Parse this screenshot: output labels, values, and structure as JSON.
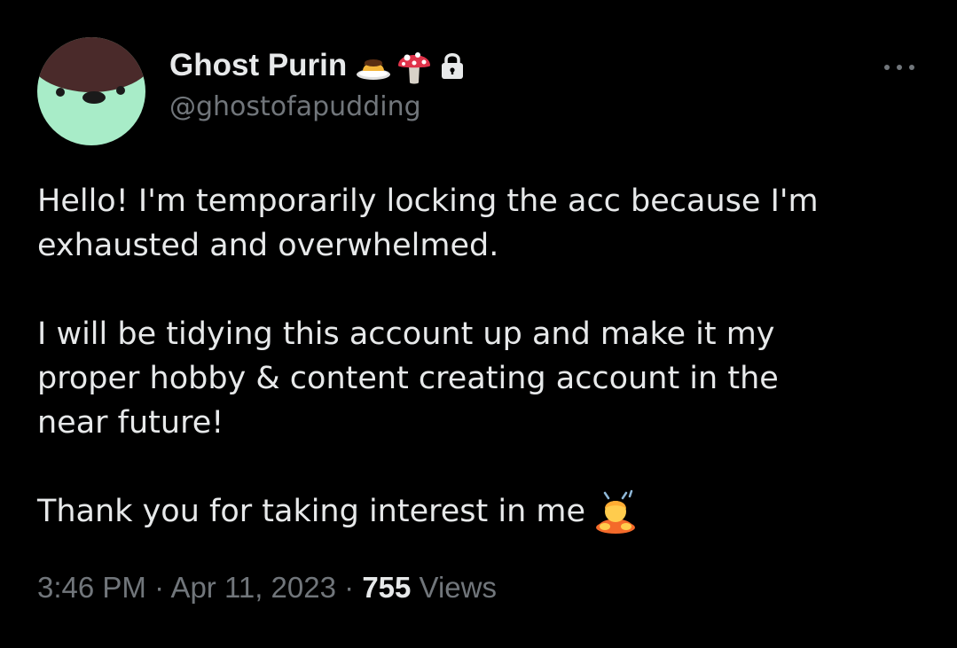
{
  "author": {
    "display_name": "Ghost Purin",
    "handle": "@ghostofapudding",
    "name_emojis": [
      "pudding-icon",
      "mushroom-icon"
    ],
    "protected_icon": "lock-icon",
    "avatar_colors": {
      "face": "#a8ecc8",
      "hair": "#4a2a2a",
      "features": "#1a1a1a"
    }
  },
  "more_icon": "more-dots-icon",
  "tweet": {
    "paragraphs": [
      [
        "Hello! I'm temporarily locking the acc because I'm",
        "exhausted and overwhelmed."
      ],
      [
        "I will be tidying this account up and make it my",
        "proper hobby & content creating account in the",
        "near future!"
      ]
    ],
    "closing_line": "Thank you for taking interest in me",
    "closing_emoji": "person-bowing-icon"
  },
  "meta": {
    "time": "3:46 PM",
    "separator": "·",
    "date": "Apr 11, 2023",
    "views_count": "755",
    "views_label": "Views"
  },
  "colors": {
    "background": "#000000",
    "primary_text": "#e7e9ea",
    "secondary_text": "#71767b"
  }
}
